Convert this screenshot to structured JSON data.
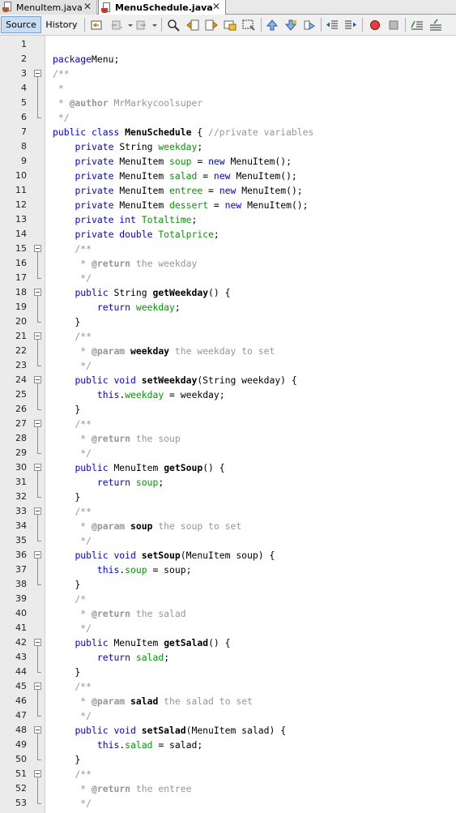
{
  "tabs": [
    {
      "label": "MenuItem.java",
      "active": false
    },
    {
      "label": "MenuSchedule.java",
      "active": true
    }
  ],
  "toolbar": {
    "source_label": "Source",
    "history_label": "History",
    "icons": [
      "last-edit-icon",
      "back-icon",
      "forward-icon",
      "find-icon",
      "find-previous-icon",
      "find-next-icon",
      "toggle-highlight-icon",
      "toggle-rect-selection-icon",
      "previous-bookmark-icon",
      "next-bookmark-icon",
      "toggle-bookmark-icon",
      "shift-left-icon",
      "shift-right-icon",
      "start-macro-icon",
      "stop-macro-icon",
      "comment-icon",
      "uncomment-icon"
    ]
  },
  "colors": {
    "keyword": "#0000e6",
    "comment": "#969696",
    "field": "#009900",
    "record": "#d04040"
  },
  "line_numbers": [
    "1",
    "2",
    "3",
    "4",
    "5",
    "6",
    "7",
    "8",
    "9",
    "10",
    "11",
    "12",
    "13",
    "14",
    "15",
    "16",
    "17",
    "18",
    "19",
    "20",
    "21",
    "22",
    "23",
    "24",
    "25",
    "26",
    "27",
    "28",
    "29",
    "30",
    "31",
    "32",
    "33",
    "34",
    "35",
    "36",
    "37",
    "38",
    "39",
    "40",
    "41",
    "42",
    "43",
    "44",
    "45",
    "46",
    "47",
    "48",
    "49",
    "50",
    "51",
    "52",
    "53"
  ],
  "code": [
    [],
    [
      [
        "kw",
        "package"
      ],
      [
        "",
        "Menu;"
      ]
    ],
    [
      [
        "cm",
        "/**"
      ]
    ],
    [
      [
        "cm",
        " *"
      ]
    ],
    [
      [
        "cm",
        " * "
      ],
      [
        "tg",
        "@author"
      ],
      [
        "cm",
        " MrMarkycoolsuper"
      ]
    ],
    [
      [
        "cm",
        " */"
      ]
    ],
    [
      [
        "kw",
        "public class "
      ],
      [
        "md",
        "MenuSchedule"
      ],
      [
        "",
        " { "
      ],
      [
        "cm",
        "//private variables"
      ]
    ],
    [
      [
        "",
        "    "
      ],
      [
        "kw",
        "private "
      ],
      [
        "",
        "String "
      ],
      [
        "fd",
        "weekday"
      ],
      [
        "",
        ";"
      ]
    ],
    [
      [
        "",
        "    "
      ],
      [
        "kw",
        "private "
      ],
      [
        "",
        "MenuItem "
      ],
      [
        "fd",
        "soup"
      ],
      [
        "",
        " = "
      ],
      [
        "kw",
        "new "
      ],
      [
        "",
        "MenuItem();"
      ]
    ],
    [
      [
        "",
        "    "
      ],
      [
        "kw",
        "private "
      ],
      [
        "",
        "MenuItem "
      ],
      [
        "fd",
        "salad"
      ],
      [
        "",
        " = "
      ],
      [
        "kw",
        "new "
      ],
      [
        "",
        "MenuItem();"
      ]
    ],
    [
      [
        "",
        "    "
      ],
      [
        "kw",
        "private "
      ],
      [
        "",
        "MenuItem "
      ],
      [
        "fd",
        "entree"
      ],
      [
        "",
        " = "
      ],
      [
        "kw",
        "new "
      ],
      [
        "",
        "MenuItem();"
      ]
    ],
    [
      [
        "",
        "    "
      ],
      [
        "kw",
        "private "
      ],
      [
        "",
        "MenuItem "
      ],
      [
        "fd",
        "dessert"
      ],
      [
        "",
        " = "
      ],
      [
        "kw",
        "new "
      ],
      [
        "",
        "MenuItem();"
      ]
    ],
    [
      [
        "",
        "    "
      ],
      [
        "kw",
        "private int "
      ],
      [
        "fd",
        "Totaltime"
      ],
      [
        "",
        ";"
      ]
    ],
    [
      [
        "",
        "    "
      ],
      [
        "kw",
        "private double "
      ],
      [
        "fd",
        "Totalprice"
      ],
      [
        "",
        ";"
      ]
    ],
    [
      [
        "cm",
        "    /**"
      ]
    ],
    [
      [
        "cm",
        "     * "
      ],
      [
        "tg",
        "@return"
      ],
      [
        "cm",
        " the weekday"
      ]
    ],
    [
      [
        "cm",
        "     */"
      ]
    ],
    [
      [
        "",
        "    "
      ],
      [
        "kw",
        "public "
      ],
      [
        "",
        "String "
      ],
      [
        "md",
        "getWeekday"
      ],
      [
        "",
        "() {"
      ]
    ],
    [
      [
        "",
        "        "
      ],
      [
        "kw",
        "return "
      ],
      [
        "fd",
        "weekday"
      ],
      [
        "",
        ";"
      ]
    ],
    [
      [
        "",
        "    }"
      ]
    ],
    [
      [
        "cm",
        "    /**"
      ]
    ],
    [
      [
        "cm",
        "     * "
      ],
      [
        "tg",
        "@param"
      ],
      [
        "",
        " "
      ],
      [
        "md",
        "weekday"
      ],
      [
        "cm",
        " the weekday to set"
      ]
    ],
    [
      [
        "cm",
        "     */"
      ]
    ],
    [
      [
        "",
        "    "
      ],
      [
        "kw",
        "public void "
      ],
      [
        "md",
        "setWeekday"
      ],
      [
        "",
        "(String weekday) {"
      ]
    ],
    [
      [
        "",
        "        "
      ],
      [
        "kw",
        "this"
      ],
      [
        "",
        "."
      ],
      [
        "fd",
        "weekday"
      ],
      [
        "",
        " = weekday;"
      ]
    ],
    [
      [
        "",
        "    }"
      ]
    ],
    [
      [
        "cm",
        "    /**"
      ]
    ],
    [
      [
        "cm",
        "     * "
      ],
      [
        "tg",
        "@return"
      ],
      [
        "cm",
        " the soup"
      ]
    ],
    [
      [
        "cm",
        "     */"
      ]
    ],
    [
      [
        "",
        "    "
      ],
      [
        "kw",
        "public "
      ],
      [
        "",
        "MenuItem "
      ],
      [
        "md",
        "getSoup"
      ],
      [
        "",
        "() {"
      ]
    ],
    [
      [
        "",
        "        "
      ],
      [
        "kw",
        "return "
      ],
      [
        "fd",
        "soup"
      ],
      [
        "",
        ";"
      ]
    ],
    [
      [
        "",
        "    }"
      ]
    ],
    [
      [
        "cm",
        "    /**"
      ]
    ],
    [
      [
        "cm",
        "     * "
      ],
      [
        "tg",
        "@param"
      ],
      [
        "",
        " "
      ],
      [
        "md",
        "soup"
      ],
      [
        "cm",
        " the soup to set"
      ]
    ],
    [
      [
        "cm",
        "     */"
      ]
    ],
    [
      [
        "",
        "    "
      ],
      [
        "kw",
        "public void "
      ],
      [
        "md",
        "setSoup"
      ],
      [
        "",
        "(MenuItem soup) {"
      ]
    ],
    [
      [
        "",
        "        "
      ],
      [
        "kw",
        "this"
      ],
      [
        "",
        "."
      ],
      [
        "fd",
        "soup"
      ],
      [
        "",
        " = soup;"
      ]
    ],
    [
      [
        "",
        "    }"
      ]
    ],
    [
      [
        "cm",
        "    /*"
      ]
    ],
    [
      [
        "cm",
        "     * "
      ],
      [
        "tg",
        "@return"
      ],
      [
        "cm",
        " the salad"
      ]
    ],
    [
      [
        "cm",
        "     */"
      ]
    ],
    [
      [
        "",
        "    "
      ],
      [
        "kw",
        "public "
      ],
      [
        "",
        "MenuItem "
      ],
      [
        "md",
        "getSalad"
      ],
      [
        "",
        "() {"
      ]
    ],
    [
      [
        "",
        "        "
      ],
      [
        "kw",
        "return "
      ],
      [
        "fd",
        "salad"
      ],
      [
        "",
        ";"
      ]
    ],
    [
      [
        "",
        "    }"
      ]
    ],
    [
      [
        "cm",
        "    /**"
      ]
    ],
    [
      [
        "cm",
        "     * "
      ],
      [
        "tg",
        "@param"
      ],
      [
        "",
        " "
      ],
      [
        "md",
        "salad"
      ],
      [
        "cm",
        " the salad to set"
      ]
    ],
    [
      [
        "cm",
        "     */"
      ]
    ],
    [
      [
        "",
        "    "
      ],
      [
        "kw",
        "public void "
      ],
      [
        "md",
        "setSalad"
      ],
      [
        "",
        "(MenuItem salad) {"
      ]
    ],
    [
      [
        "",
        "        "
      ],
      [
        "kw",
        "this"
      ],
      [
        "",
        "."
      ],
      [
        "fd",
        "salad"
      ],
      [
        "",
        " = salad;"
      ]
    ],
    [
      [
        "",
        "    }"
      ]
    ],
    [
      [
        "cm",
        "    /**"
      ]
    ],
    [
      [
        "cm",
        "     * "
      ],
      [
        "tg",
        "@return"
      ],
      [
        "cm",
        " the entree"
      ]
    ],
    [
      [
        "cm",
        "     */"
      ]
    ]
  ],
  "folds": [
    {
      "start": 3,
      "end": 6
    },
    {
      "start": 15,
      "end": 17
    },
    {
      "start": 18,
      "end": 20
    },
    {
      "start": 21,
      "end": 23
    },
    {
      "start": 24,
      "end": 26
    },
    {
      "start": 27,
      "end": 29
    },
    {
      "start": 30,
      "end": 32
    },
    {
      "start": 33,
      "end": 35
    },
    {
      "start": 36,
      "end": 38
    },
    {
      "start": 42,
      "end": 44
    },
    {
      "start": 45,
      "end": 47
    },
    {
      "start": 48,
      "end": 50
    },
    {
      "start": 51,
      "end": 53
    }
  ]
}
